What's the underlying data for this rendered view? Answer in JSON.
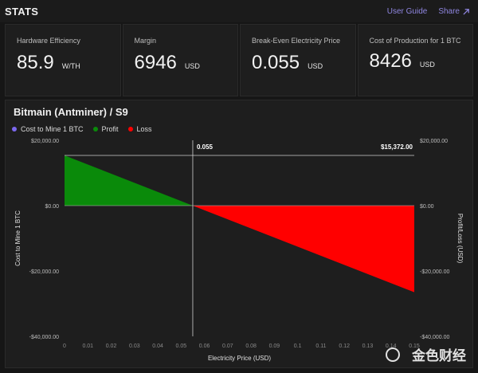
{
  "header": {
    "title": "STATS",
    "user_guide": "User Guide",
    "share": "Share"
  },
  "cards": [
    {
      "label": "Hardware Efficiency",
      "value": "85.9",
      "unit": "W/TH"
    },
    {
      "label": "Margin",
      "value": "6946",
      "unit": "USD"
    },
    {
      "label": "Break-Even Electricity Price",
      "value": "0.055",
      "unit": "USD"
    },
    {
      "label": "Cost of Production for 1 BTC",
      "value": "8426",
      "unit": "USD"
    }
  ],
  "chart": {
    "title": "Bitmain (Antminer) / S9",
    "legend": [
      {
        "label": "Cost to Mine 1 BTC",
        "color": "#7b68ee"
      },
      {
        "label": "Profit",
        "color": "#0a8a0a"
      },
      {
        "label": "Loss",
        "color": "#ff0000"
      }
    ],
    "break_even_label": "0.055",
    "value_label": "$15,372.00"
  },
  "chart_data": {
    "type": "area",
    "xlabel": "Electricity Price (USD)",
    "ylabel_left": "Cost to Mine 1 BTC",
    "ylabel_right": "Profit/Loss (USD)",
    "x_ticks": [
      "0",
      "0.01",
      "0.02",
      "0.03",
      "0.04",
      "0.05",
      "0.06",
      "0.07",
      "0.08",
      "0.09",
      "0.1",
      "0.11",
      "0.12",
      "0.13",
      "0.14",
      "0.15"
    ],
    "y_ticks_left": [
      "$20,000.00",
      "$0.00",
      "-$20,000.00",
      "-$40,000.00"
    ],
    "y_ticks_right": [
      "$20,000.00",
      "$0.00",
      "-$20,000.00",
      "-$40,000.00"
    ],
    "xlim": [
      0,
      0.15
    ],
    "ylim": [
      -40000,
      20000
    ],
    "break_even_x": 0.055,
    "crosshair_y": 15372,
    "series": [
      {
        "name": "Profit",
        "color": "#0a8a0a",
        "x": [
          0,
          0.055
        ],
        "y": [
          15372,
          0
        ]
      },
      {
        "name": "Loss",
        "color": "#ff0000",
        "x": [
          0.055,
          0.15
        ],
        "y": [
          0,
          -26500
        ]
      }
    ],
    "grid": false
  },
  "watermark": {
    "text": "金色财经"
  }
}
